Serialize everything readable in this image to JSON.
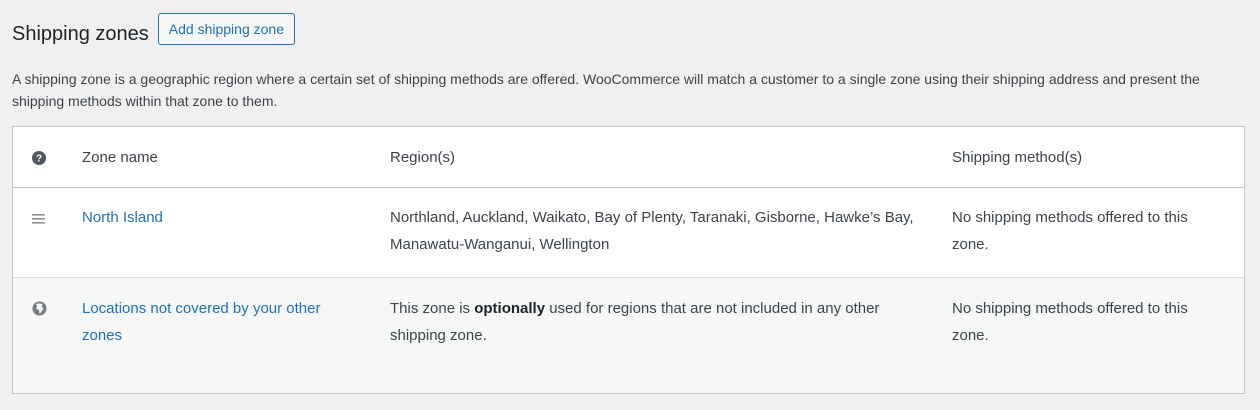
{
  "header": {
    "title": "Shipping zones",
    "add_button_label": "Add shipping zone"
  },
  "description": "A shipping zone is a geographic region where a certain set of shipping methods are offered. WooCommerce will match a customer to a single zone using their shipping address and present the shipping methods within that zone to them.",
  "table": {
    "columns": {
      "help_icon": "help-icon",
      "zone_name": "Zone name",
      "regions": "Region(s)",
      "methods": "Shipping method(s)"
    },
    "rows": [
      {
        "icon": "drag-handle-icon",
        "zone_name": "North Island",
        "regions": "Northland, Auckland, Waikato, Bay of Plenty, Taranaki, Gisborne, Hawke’s Bay, Manawatu-Wanganui, Wellington",
        "methods": "No shipping methods offered to this zone."
      },
      {
        "icon": "globe-icon",
        "zone_name": "Locations not covered by your other zones",
        "regions_prefix": "This zone is ",
        "regions_bold": "optionally",
        "regions_suffix": " used for regions that are not included in any other shipping zone.",
        "methods": "No shipping methods offered to this zone."
      }
    ]
  },
  "colors": {
    "accent": "#2271b1",
    "background": "#f0f0f1",
    "border": "#c3c4c7"
  }
}
